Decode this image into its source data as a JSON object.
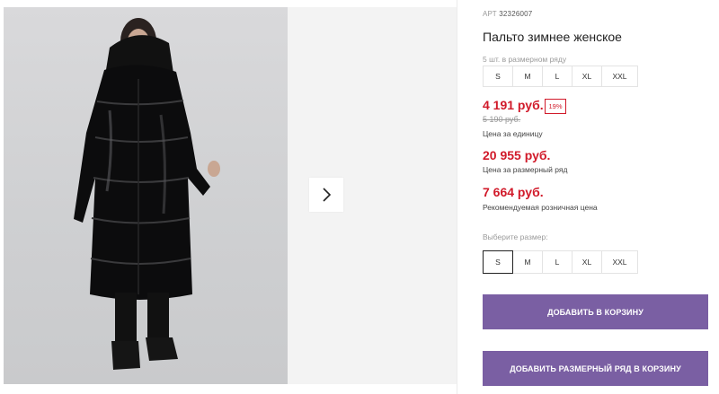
{
  "gallery": {
    "next_icon": "chevron-right-icon"
  },
  "product": {
    "sku_label": "АРТ",
    "sku": "32326007",
    "title": "Пальто зимнее женское",
    "row_hint": "5 шт. в размерном ряду",
    "row_sizes": [
      "S",
      "M",
      "L",
      "XL",
      "XXL"
    ],
    "price": "4 191 руб.",
    "discount": "19%",
    "old_price": "5 190 руб.",
    "price_caption": "Цена за единицу",
    "row_price": "20 955 руб.",
    "row_price_caption": "Цена за размерный ряд",
    "retail_price": "7 664 руб.",
    "retail_caption": "Рекомендуемая розничная цена",
    "select_label": "Выберите размер:",
    "select_sizes": [
      "S",
      "M",
      "L",
      "XL",
      "XXL"
    ],
    "selected_size": "S"
  },
  "actions": {
    "add_to_cart": "ДОБАВИТЬ В КОРЗИНУ",
    "add_row_to_cart": "ДОБАВИТЬ РАЗМЕРНЫЙ РЯД В КОРЗИНУ"
  },
  "colors": {
    "price_red": "#d11a2a",
    "button_purple": "#7a5fa3"
  }
}
